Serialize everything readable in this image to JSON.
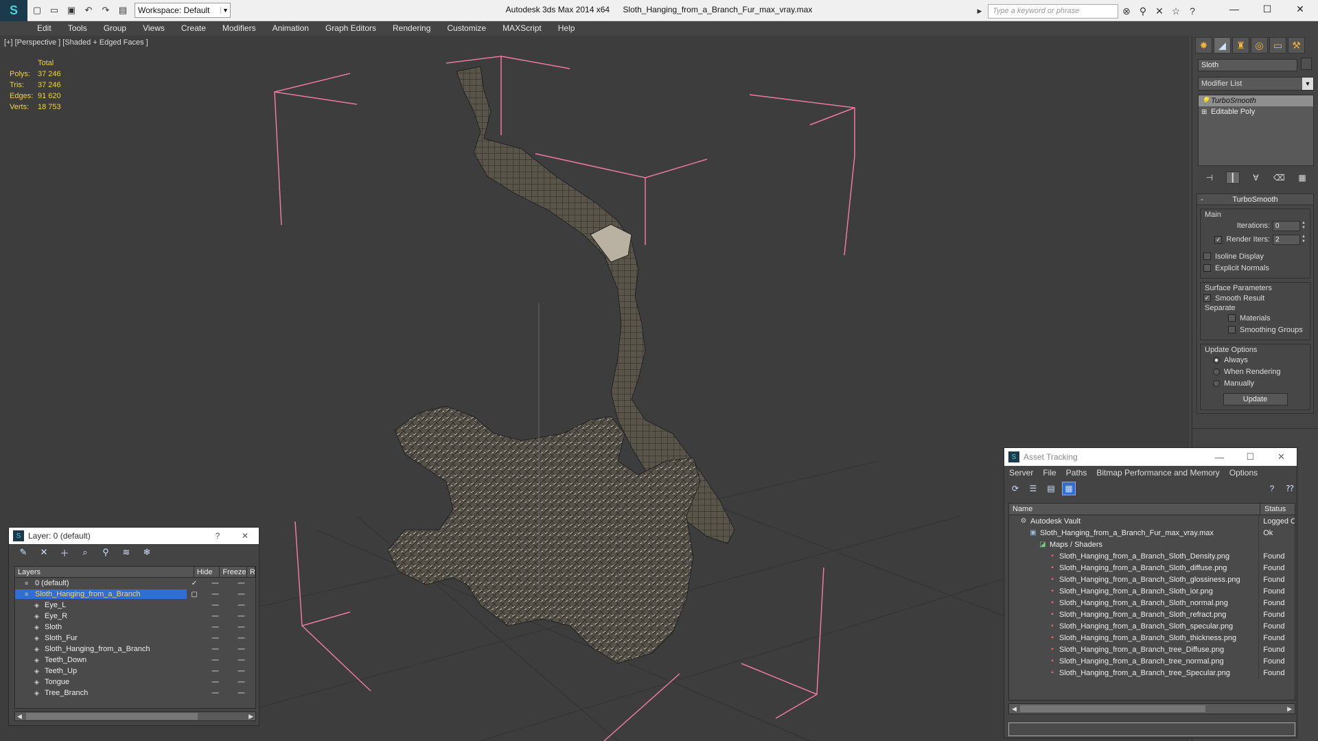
{
  "app": {
    "logo": "S",
    "title": "Autodesk 3ds Max  2014 x64",
    "file": "Sloth_Hanging_from_a_Branch_Fur_max_vray.max",
    "workspace": "Workspace: Default",
    "search_placeholder": "Type a keyword or phrase"
  },
  "menu": [
    "Edit",
    "Tools",
    "Group",
    "Views",
    "Create",
    "Modifiers",
    "Animation",
    "Graph Editors",
    "Rendering",
    "Customize",
    "MAXScript",
    "Help"
  ],
  "viewport": {
    "label": "[+] [Perspective ] [Shaded + Edged Faces ]",
    "stats": {
      "header": "Total",
      "rows": [
        {
          "k": "Polys:",
          "v": "37 246"
        },
        {
          "k": "Tris:",
          "v": "37 246"
        },
        {
          "k": "Edges:",
          "v": "91 620"
        },
        {
          "k": "Verts:",
          "v": "18 753"
        }
      ]
    }
  },
  "command_panel": {
    "object_name": "Sloth",
    "modifier_list": "Modifier List",
    "stack": [
      {
        "label": "TurboSmooth",
        "selected": true
      },
      {
        "label": "Editable Poly",
        "selected": false
      }
    ],
    "rollout_title": "TurboSmooth",
    "main_title": "Main",
    "iterations_label": "Iterations:",
    "iterations_value": "0",
    "render_iters_label": "Render Iters:",
    "render_iters_value": "2",
    "isoline": "Isoline Display",
    "explicit_normals": "Explicit Normals",
    "surface_title": "Surface Parameters",
    "smooth_result": "Smooth Result",
    "separate": "Separate",
    "materials": "Materials",
    "smoothing_groups": "Smoothing Groups",
    "update_title": "Update Options",
    "always": "Always",
    "when_rendering": "When Rendering",
    "manually": "Manually",
    "update_btn": "Update"
  },
  "layer_dialog": {
    "title": "Layer: 0 (default)",
    "help": "?",
    "close": "✕",
    "columns": {
      "layers": "Layers",
      "hide": "Hide",
      "freeze": "Freeze",
      "r": "R"
    },
    "rows": [
      {
        "name": "0 (default)",
        "indent": 1,
        "icon": "≡",
        "check": "✓",
        "selected": false
      },
      {
        "name": "Sloth_Hanging_from_a_Branch",
        "indent": 1,
        "icon": "≡",
        "check": "▢",
        "selected": true
      },
      {
        "name": "Eye_L",
        "indent": 2,
        "icon": "◈",
        "check": "",
        "selected": false
      },
      {
        "name": "Eye_R",
        "indent": 2,
        "icon": "◈",
        "check": "",
        "selected": false
      },
      {
        "name": "Sloth",
        "indent": 2,
        "icon": "◈",
        "check": "",
        "selected": false
      },
      {
        "name": "Sloth_Fur",
        "indent": 2,
        "icon": "◈",
        "check": "",
        "selected": false
      },
      {
        "name": "Sloth_Hanging_from_a_Branch",
        "indent": 2,
        "icon": "◈",
        "check": "",
        "selected": false
      },
      {
        "name": "Teeth_Down",
        "indent": 2,
        "icon": "◈",
        "check": "",
        "selected": false
      },
      {
        "name": "Teeth_Up",
        "indent": 2,
        "icon": "◈",
        "check": "",
        "selected": false
      },
      {
        "name": "Tongue",
        "indent": 2,
        "icon": "◈",
        "check": "",
        "selected": false
      },
      {
        "name": "Tree_Branch",
        "indent": 2,
        "icon": "◈",
        "check": "",
        "selected": false
      }
    ],
    "dash": "━━"
  },
  "asset_dialog": {
    "title": "Asset Tracking",
    "menu": [
      "Server",
      "File",
      "Paths",
      "Bitmap Performance and Memory",
      "Options"
    ],
    "columns": {
      "name": "Name",
      "status": "Status"
    },
    "rows": [
      {
        "name": "Autodesk Vault",
        "status": "Logged Out",
        "indent": 1,
        "type": "vault"
      },
      {
        "name": "Sloth_Hanging_from_a_Branch_Fur_max_vray.max",
        "status": "Ok",
        "indent": 2,
        "type": "max"
      },
      {
        "name": "Maps / Shaders",
        "status": "",
        "indent": 3,
        "type": "maps"
      },
      {
        "name": "Sloth_Hanging_from_a_Branch_Sloth_Density.png",
        "status": "Found",
        "indent": 4,
        "type": "png"
      },
      {
        "name": "Sloth_Hanging_from_a_Branch_Sloth_diffuse.png",
        "status": "Found",
        "indent": 4,
        "type": "png"
      },
      {
        "name": "Sloth_Hanging_from_a_Branch_Sloth_glossiness.png",
        "status": "Found",
        "indent": 4,
        "type": "png"
      },
      {
        "name": "Sloth_Hanging_from_a_Branch_Sloth_ior.png",
        "status": "Found",
        "indent": 4,
        "type": "png"
      },
      {
        "name": "Sloth_Hanging_from_a_Branch_Sloth_normal.png",
        "status": "Found",
        "indent": 4,
        "type": "png"
      },
      {
        "name": "Sloth_Hanging_from_a_Branch_Sloth_refract.png",
        "status": "Found",
        "indent": 4,
        "type": "png"
      },
      {
        "name": "Sloth_Hanging_from_a_Branch_Sloth_specular.png",
        "status": "Found",
        "indent": 4,
        "type": "png"
      },
      {
        "name": "Sloth_Hanging_from_a_Branch_Sloth_thickness.png",
        "status": "Found",
        "indent": 4,
        "type": "png"
      },
      {
        "name": "Sloth_Hanging_from_a_Branch_tree_Diffuse.png",
        "status": "Found",
        "indent": 4,
        "type": "png"
      },
      {
        "name": "Sloth_Hanging_from_a_Branch_tree_normal.png",
        "status": "Found",
        "indent": 4,
        "type": "png"
      },
      {
        "name": "Sloth_Hanging_from_a_Branch_tree_Specular.png",
        "status": "Found",
        "indent": 4,
        "type": "png"
      }
    ]
  }
}
